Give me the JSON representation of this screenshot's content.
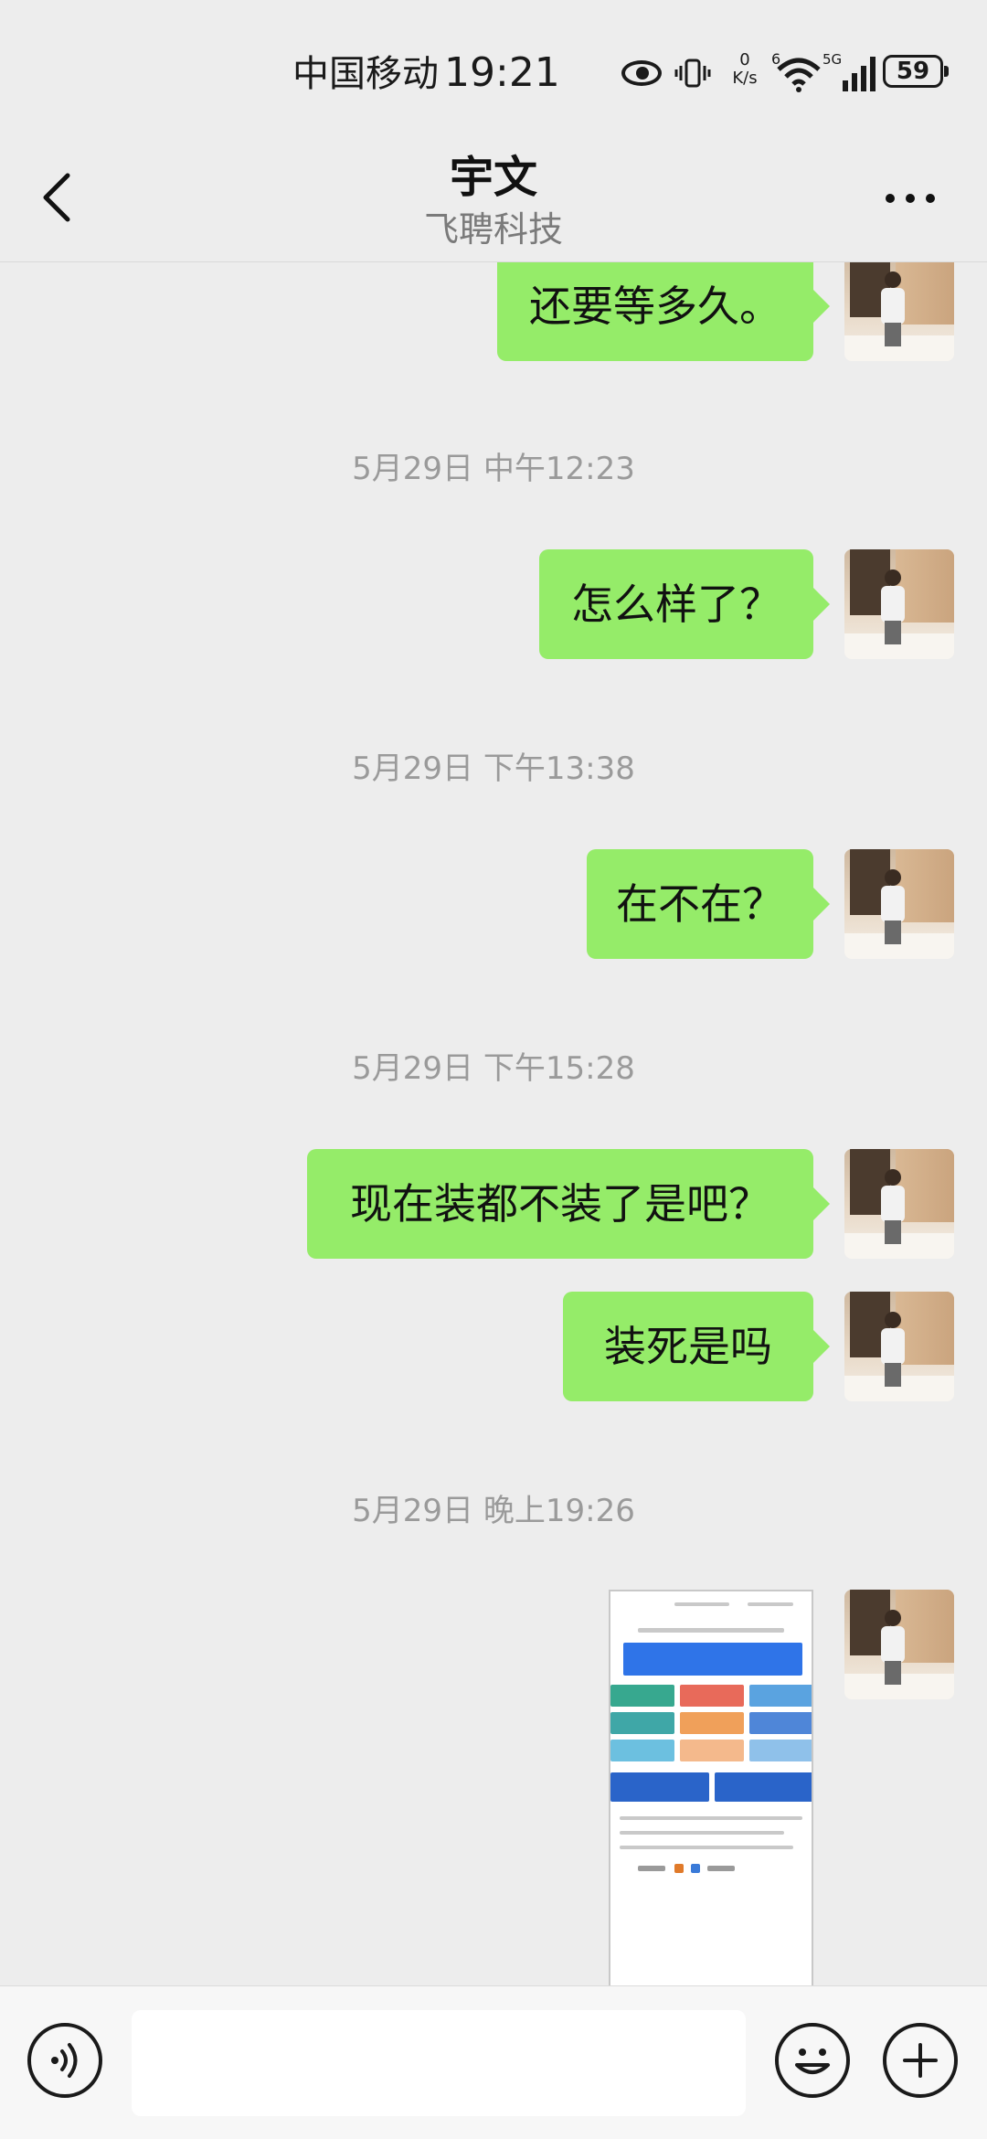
{
  "status_bar": {
    "carrier": "中国移动",
    "time": "19:21",
    "speed_value": "0",
    "speed_unit": "K/s",
    "wifi_badge": "6",
    "network": "5G",
    "battery": "59",
    "icons": [
      "eye-icon",
      "vibrate-icon",
      "wifi-icon",
      "signal-icon",
      "battery-icon"
    ]
  },
  "header": {
    "title": "宇文",
    "subtitle": "飞聘科技",
    "back_icon": "chevron-left-icon",
    "more_icon": "more-dots-icon"
  },
  "messages": [
    {
      "type": "text",
      "text": "还要等多久。",
      "sender": "self"
    },
    {
      "type": "timestamp",
      "text": "5月29日 中午12:23"
    },
    {
      "type": "text",
      "text": "怎么样了？",
      "sender": "self"
    },
    {
      "type": "timestamp",
      "text": "5月29日 下午13:38"
    },
    {
      "type": "text",
      "text": "在不在？",
      "sender": "self"
    },
    {
      "type": "timestamp",
      "text": "5月29日 下午15:28"
    },
    {
      "type": "text",
      "text": "现在装都不装了是吧？",
      "sender": "self"
    },
    {
      "type": "text",
      "text": "装死是吗",
      "sender": "self"
    },
    {
      "type": "timestamp",
      "text": "5月29日 晚上19:26"
    },
    {
      "type": "image",
      "sender": "self"
    }
  ],
  "colors": {
    "background": "#ededed",
    "bubble_self": "#95ec69",
    "timestamp": "#9a9a9a",
    "subtitle": "#7a7a7a"
  },
  "input_bar": {
    "voice_icon": "voice-icon",
    "emoji_icon": "emoji-icon",
    "plus_icon": "plus-icon",
    "input_value": ""
  }
}
